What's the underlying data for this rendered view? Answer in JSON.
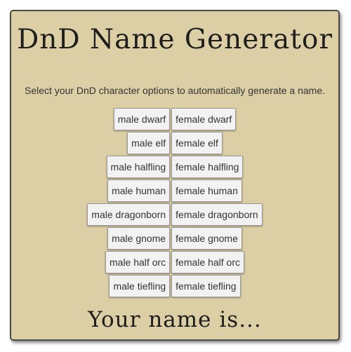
{
  "title": "DnD Name Generator",
  "instructions": "Select your DnD character options to automatically generate a name.",
  "options": [
    {
      "male": "male dwarf",
      "female": "female dwarf"
    },
    {
      "male": "male elf",
      "female": "female elf"
    },
    {
      "male": "male halfling",
      "female": "female halfling"
    },
    {
      "male": "male human",
      "female": "female human"
    },
    {
      "male": "male dragonborn",
      "female": "female dragonborn"
    },
    {
      "male": "male gnome",
      "female": "female gnome"
    },
    {
      "male": "male half orc",
      "female": "female half orc"
    },
    {
      "male": "male tiefling",
      "female": "female tiefling"
    }
  ],
  "result": "Your name is..."
}
